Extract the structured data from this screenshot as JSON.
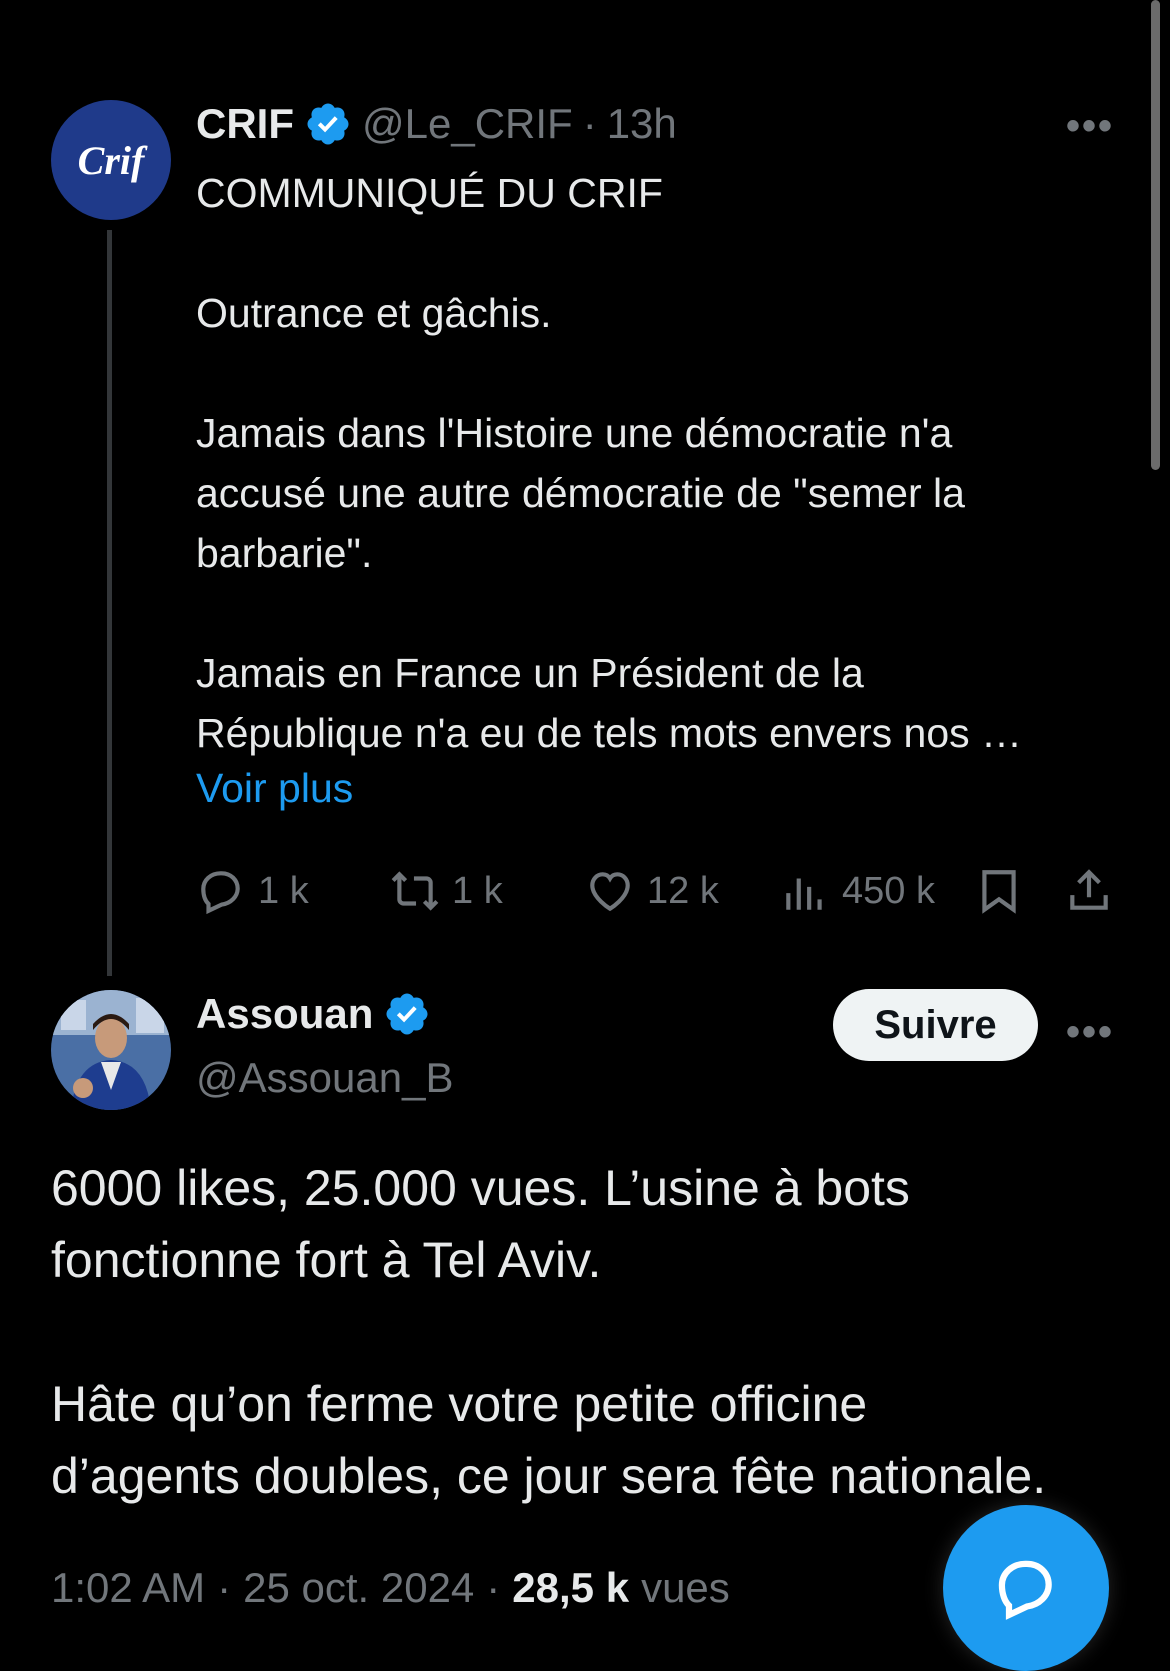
{
  "quoted_tweet": {
    "avatar_text": "Crif",
    "name": "CRIF",
    "handle": "@Le_CRIF",
    "separator": "·",
    "time": "13h",
    "text": "COMMUNIQUÉ DU CRIF\n\nOutrance et gâchis.\n\nJamais dans l'Histoire une démocratie n'a\naccusé une autre démocratie de \"semer la\nbarbarie\".\n\nJamais en France un Président de la\nRépublique n'a eu de tels mots envers nos …",
    "see_more": "Voir plus",
    "actions": {
      "reply_count": "1 k",
      "retweet_count": "1 k",
      "like_count": "12 k",
      "view_count": "450 k"
    }
  },
  "main_tweet": {
    "name": "Assouan",
    "handle": "@Assouan_B",
    "follow_label": "Suivre",
    "text": "6000 likes, 25.000 vues. L’usine à bots\nfonctionne fort à Tel Aviv.\n\nHâte qu’on ferme votre petite officine\nd’agents doubles, ce jour sera fête nationale.",
    "time": "1:02 AM",
    "date": "25 oct. 2024",
    "views_count": "28,5 k",
    "views_label": "vues",
    "separator": "·"
  },
  "colors": {
    "background": "#000000",
    "accent": "#1d9bf0",
    "muted": "#71767b",
    "text": "#e7e9ea"
  }
}
